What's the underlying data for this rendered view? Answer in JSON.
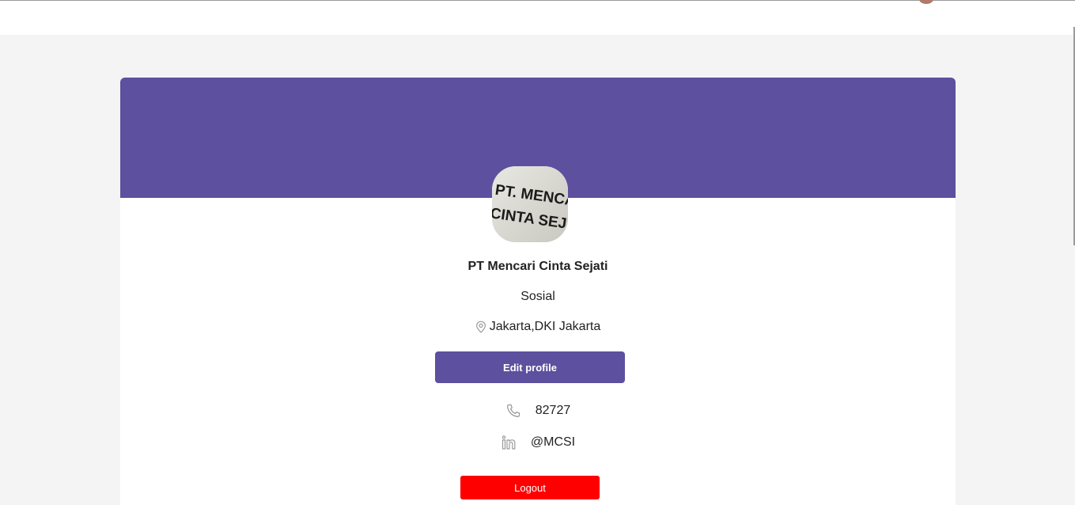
{
  "profile": {
    "company_name": "PT Mencari Cinta Sejati",
    "industry": "Sosial",
    "location": "Jakarta,DKI Jakarta",
    "avatar_text_line1": "PT. MENCARI",
    "avatar_text_line2": "CINTA SEJATI"
  },
  "actions": {
    "edit_label": "Edit profile",
    "logout_label": "Logout"
  },
  "contacts": {
    "phone": "82727",
    "linkedin": "@MCSI"
  },
  "icons": {
    "location": "map-pin-icon",
    "phone": "phone-icon",
    "linkedin": "linkedin-icon"
  },
  "colors": {
    "brand": "#5d509f",
    "logout": "#ff0000",
    "background": "#f4f4f4"
  }
}
